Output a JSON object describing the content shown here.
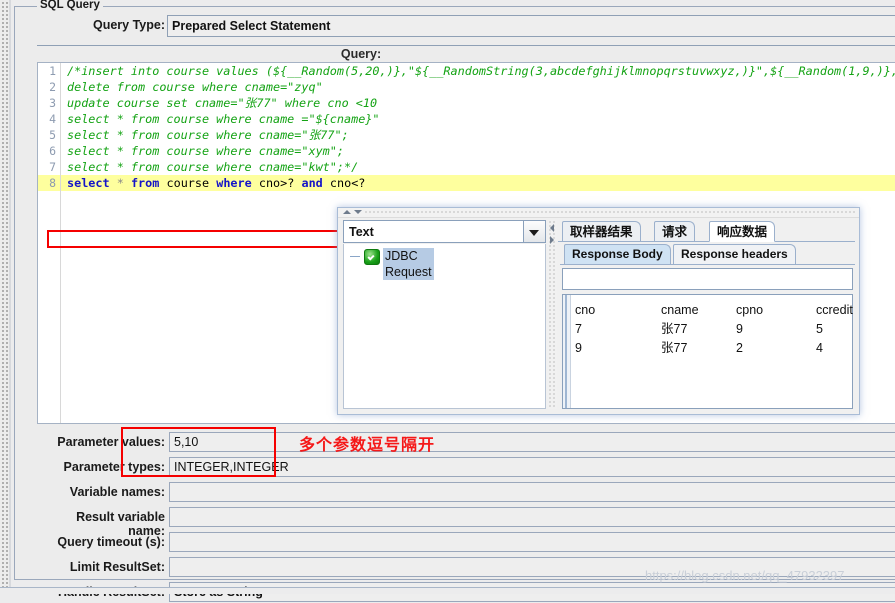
{
  "panel": {
    "title": "SQL Query",
    "query_type_label": "Query Type:",
    "query_type_value": "Prepared Select Statement",
    "query_caption": "Query:"
  },
  "editor": {
    "line_numbers": [
      "1",
      "2",
      "3",
      "4",
      "5",
      "6",
      "7",
      "8"
    ],
    "lines": [
      "/*insert into course values (${__Random(5,20,)},\"${__RandomString(3,abcdefghijklmnopqrstuvwxyz,)}\",${__Random(1,9,)},${__",
      "delete from course where cname=\"zyq\"",
      "update course set cname=\"张77\" where cno <10",
      "select * from course where cname =\"${cname}\"",
      "select * from course where cname=\"张77\";",
      "select * from course where cname=\"xym\";",
      "select * from course where cname=\"kwt\";*/",
      "select * from course where cno>? and cno<?"
    ],
    "active_line_tokens": {
      "kw1": "select",
      "star": "*",
      "kw2": "from",
      "tbl": "course",
      "kw3": "where",
      "expr1": "cno>?",
      "kw4": "and",
      "expr2": "cno<?"
    }
  },
  "popup": {
    "combo_value": "Text",
    "tree_item": "JDBC Request",
    "tabs": [
      {
        "label": "取样器结果",
        "selected": false
      },
      {
        "label": "请求",
        "selected": false
      },
      {
        "label": "响应数据",
        "selected": true
      }
    ],
    "subtabs": [
      {
        "label": "Response Body",
        "selected": true
      },
      {
        "label": "Response headers",
        "selected": false
      }
    ],
    "search_value": "",
    "result_table": {
      "headers": [
        "cno",
        "cname",
        "cpno",
        "ccredit"
      ],
      "rows": [
        [
          "7",
          "张77",
          "9",
          "5"
        ],
        [
          "9",
          "张77",
          "2",
          "4"
        ]
      ]
    }
  },
  "form": {
    "fields": [
      {
        "label": "Parameter values:",
        "value": "5,10",
        "bold": false
      },
      {
        "label": "Parameter types:",
        "value": "INTEGER,INTEGER",
        "bold": false
      },
      {
        "label": "Variable names:",
        "value": "",
        "bold": false
      },
      {
        "label": "Result variable name:",
        "value": "",
        "bold": false
      },
      {
        "label": "Query timeout (s):",
        "value": "",
        "bold": false
      },
      {
        "label": "Limit ResultSet:",
        "value": "",
        "bold": false
      },
      {
        "label": "Handle ResultSet:",
        "value": "Store as String",
        "bold": true
      }
    ]
  },
  "annotations": {
    "note_text": "多个参数逗号隔开",
    "note_color": "#f51818",
    "box_color": "#f50000"
  },
  "watermark": {
    "text": "https://blog.csdn.net/qq_47932397"
  }
}
